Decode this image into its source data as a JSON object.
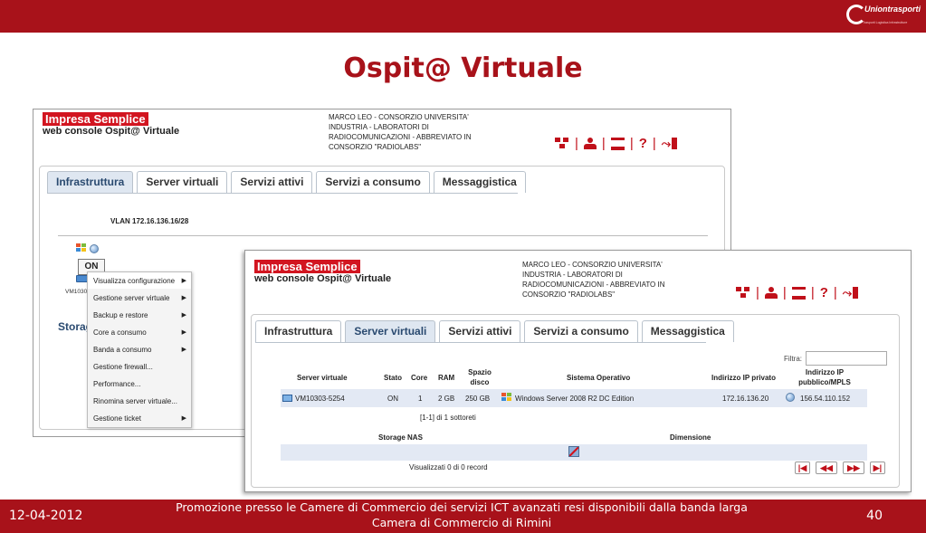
{
  "slide": {
    "title": "Ospit@ Virtuale",
    "logo_text": "Uniontrasporti",
    "logo_sub": "Trasporti Logistica Infrastrutture",
    "footer_date": "12-04-2012",
    "footer_line1": "Promozione presso le Camere di Commercio dei servizi ICT avanzati resi disponibili dalla banda larga",
    "footer_line2": "Camera di Commercio di Rimini",
    "page_number": "40",
    "accent_color": "#a8121a"
  },
  "app": {
    "brand": "Impresa Semplice",
    "console": "web console Ospit@ Virtuale",
    "user_line1": "MARCO LEO - CONSORZIO UNIVERSITA'",
    "user_line2": "INDUSTRIA - LABORATORI DI",
    "user_line3": "RADIOCOMUNICAZIONI - ABBREVIATO IN",
    "user_line4": "CONSORZIO \"RADIOLABS\"",
    "icons": [
      "network-icon",
      "user-icon",
      "cart-icon",
      "help-icon",
      "logout-icon"
    ],
    "help_glyph": "?",
    "tabs": [
      "Infrastruttura",
      "Server virtuali",
      "Servizi attivi",
      "Servizi a consumo",
      "Messaggistica"
    ]
  },
  "infra": {
    "vlan": "VLAN 172.16.136.16/28",
    "on_label": "ON",
    "vm_label": "VM10303",
    "storage_label": "Storag",
    "context_menu": [
      {
        "label": "Visualizza configurazione",
        "submenu": true
      },
      {
        "label": "Gestione server virtuale",
        "submenu": true
      },
      {
        "label": "Backup e restore",
        "submenu": true
      },
      {
        "label": "Core a consumo",
        "submenu": true
      },
      {
        "label": "Banda a consumo",
        "submenu": true
      },
      {
        "label": "Gestione firewall...",
        "submenu": false
      },
      {
        "label": "Performance...",
        "submenu": false
      },
      {
        "label": "Rinomina server virtuale...",
        "submenu": false
      },
      {
        "label": "Gestione ticket",
        "submenu": true
      }
    ]
  },
  "servers": {
    "filter_label": "Filtra:",
    "filter_value": "",
    "headers": {
      "name": "Server virtuale",
      "stato": "Stato",
      "core": "Core",
      "ram": "RAM",
      "disco_1": "Spazio",
      "disco_2": "disco",
      "os": "Sistema Operativo",
      "ip_priv": "Indirizzo IP privato",
      "ip_pub_1": "Indirizzo IP",
      "ip_pub_2": "pubblico/MPLS"
    },
    "rows": [
      {
        "name": "VM10303-5254",
        "stato": "ON",
        "core": "1",
        "ram": "2 GB",
        "disco": "250 GB",
        "os": "Windows Server 2008 R2 DC Edition",
        "ip_priv": "172.16.136.20",
        "ip_pub": "156.54.110.152"
      }
    ],
    "pagination": "[1-1] di 1 sottoreti",
    "storage_header": "Storage NAS",
    "dimension_header": "Dimensione",
    "records": "Visualizzati 0 di 0 record",
    "pager": [
      "first-page-button",
      "prev-page-button",
      "next-page-button",
      "last-page-button"
    ],
    "pager_glyphs": [
      "|◀",
      "◀◀",
      "▶▶",
      "▶|"
    ]
  }
}
